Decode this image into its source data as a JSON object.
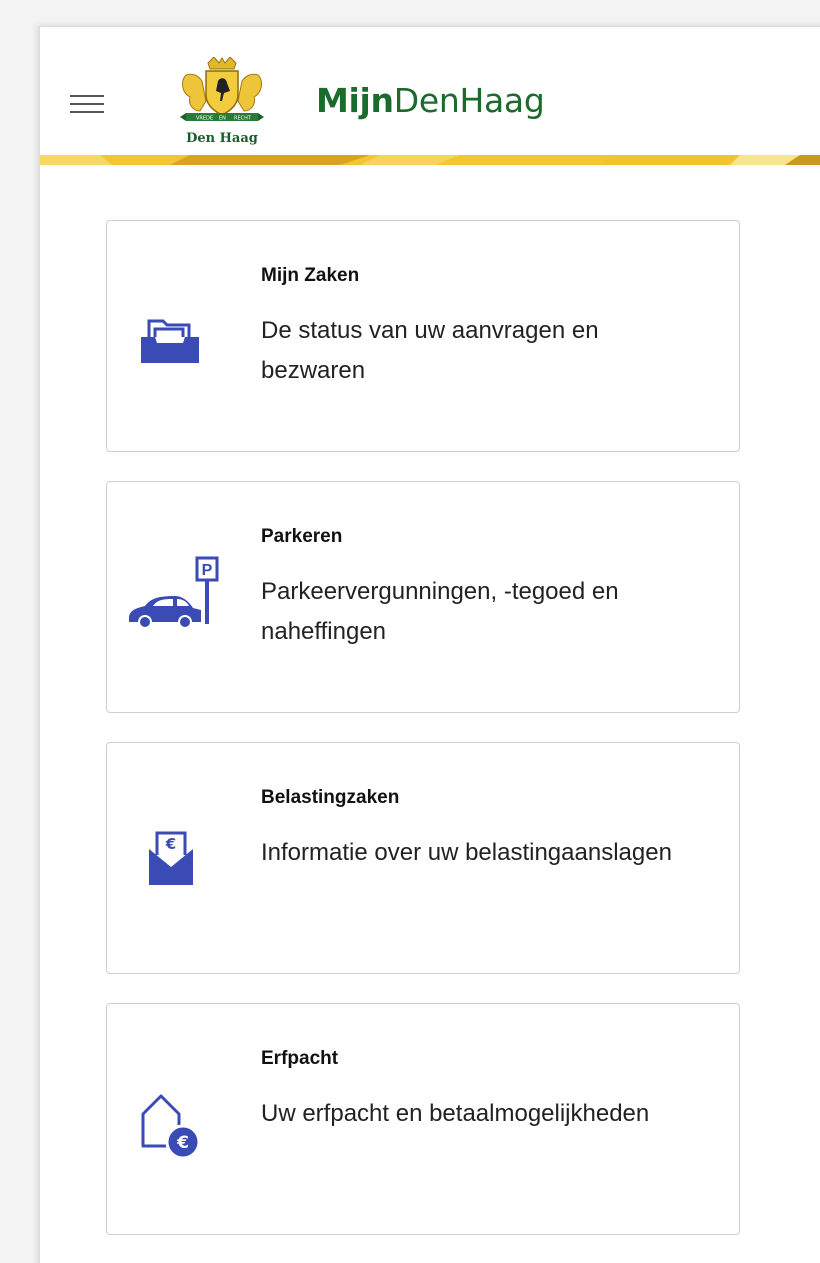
{
  "header": {
    "brand_bold": "Mijn",
    "brand_rest": "DenHaag",
    "logo_caption": "Den Haag",
    "logo_motto_left": "VREDE",
    "logo_motto_mid": "EN",
    "logo_motto_right": "RECHT"
  },
  "colors": {
    "brand_green": "#1b6b2c",
    "icon_blue": "#3a4bb5",
    "gold": "#f2c531",
    "gold_dark": "#d7a21e"
  },
  "cards": [
    {
      "title": "Mijn Zaken",
      "description": "De status van uw aanvragen en bezwaren",
      "icon": "folder-tray-icon"
    },
    {
      "title": "Parkeren",
      "description": "Parkeervergunningen, -tegoed en naheffingen",
      "icon": "car-parking-icon"
    },
    {
      "title": "Belastingzaken",
      "description": "Informatie over uw belastingaanslagen",
      "icon": "envelope-euro-icon"
    },
    {
      "title": "Erfpacht",
      "description": "Uw erfpacht en betaalmogelijkheden",
      "icon": "house-euro-icon"
    }
  ],
  "icon_labels": {
    "parking_sign": "P",
    "euro": "€"
  }
}
